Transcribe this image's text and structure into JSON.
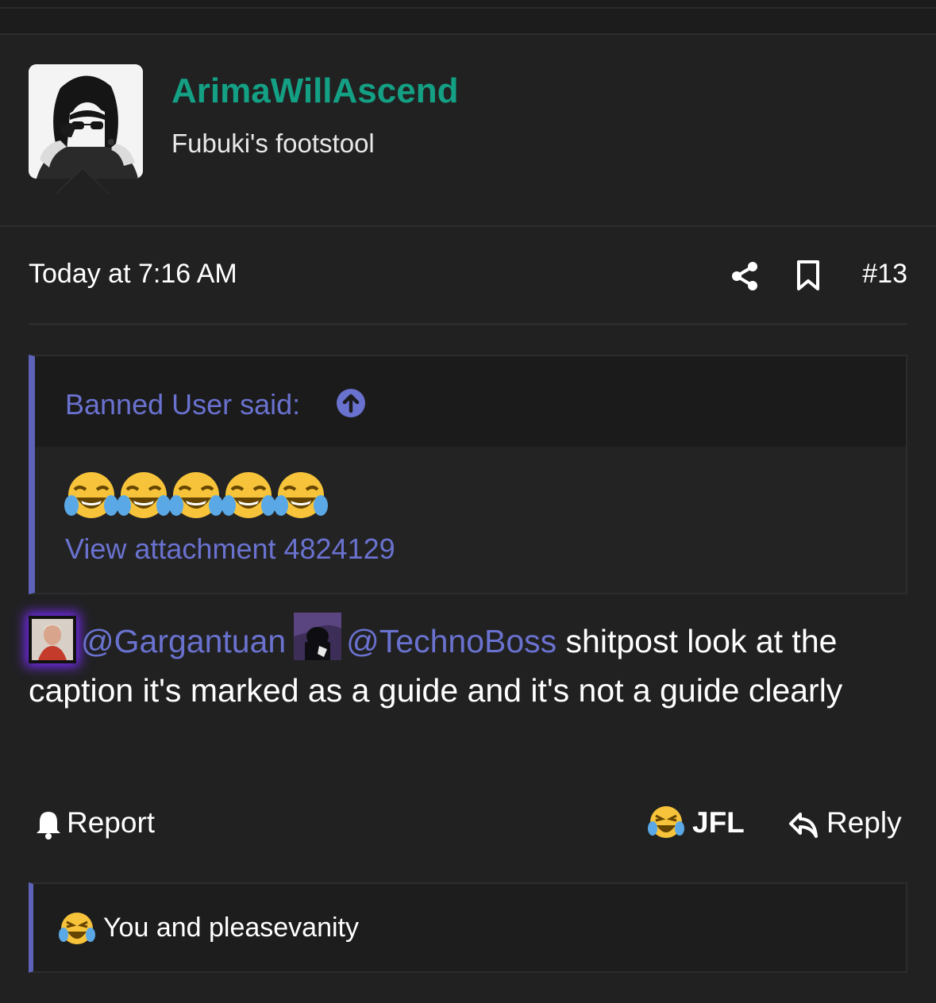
{
  "user": {
    "name": "ArimaWillAscend",
    "title": "Fubuki's footstool"
  },
  "post": {
    "time": "Today at 7:16 AM",
    "number": "#13"
  },
  "quote": {
    "author": "Banned User said:",
    "emoji_count": 5,
    "emoji": "face-with-tears-of-joy",
    "attachment": "View attachment 4824129"
  },
  "message": {
    "mention1": "@Gargantuan",
    "mention2": "@TechnoBoss",
    "text_part1": " shitpost look at the caption it's marked as a guide and it's not a guide clearly"
  },
  "actions": {
    "report": "Report",
    "reaction": "JFL",
    "reply": "Reply"
  },
  "reactions": {
    "summary": "You and pleasevanity"
  },
  "colors": {
    "username": "#14a084",
    "link": "#6a72cf",
    "quote_border": "#5c63b8",
    "background": "#212122"
  }
}
